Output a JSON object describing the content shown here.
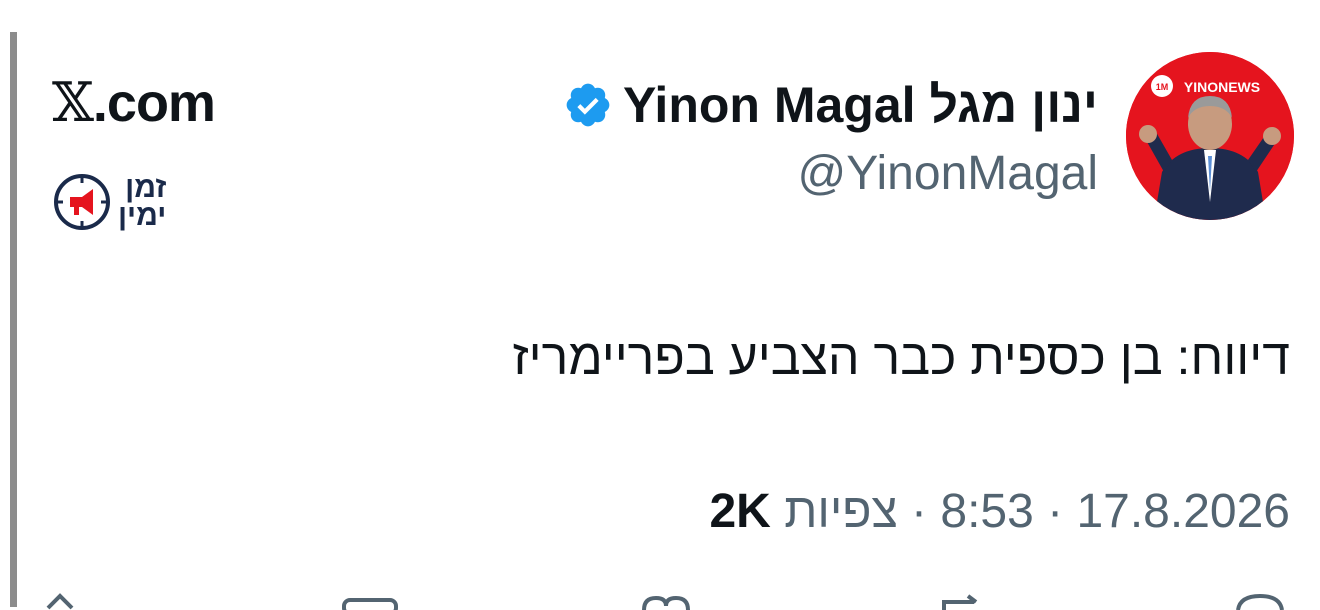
{
  "site": {
    "brand": ".com",
    "brand_x": "𝕏"
  },
  "logo": {
    "line1": "זמן",
    "line2": "ימין"
  },
  "author": {
    "display_name": "Yinon Magal ינון מגל",
    "handle": "@YinonMagal",
    "verified": true,
    "avatar_badge": "YINONEWS",
    "avatar_badge_small": "1M"
  },
  "tweet": {
    "text": "דיווח: בן כספית כבר הצביע בפריימריז",
    "date": "17.8.2026",
    "time": "8:53",
    "views_label": "צפיות",
    "views_count": "2K"
  },
  "colors": {
    "verified": "#1d9bf0",
    "avatar_bg": "#e5141e",
    "secondary_text": "#536471"
  },
  "icons": [
    "x-logo-icon",
    "verified-badge-icon",
    "clock-megaphone-icon",
    "reply-icon",
    "retweet-icon",
    "like-icon",
    "bookmark-icon",
    "share-icon"
  ]
}
